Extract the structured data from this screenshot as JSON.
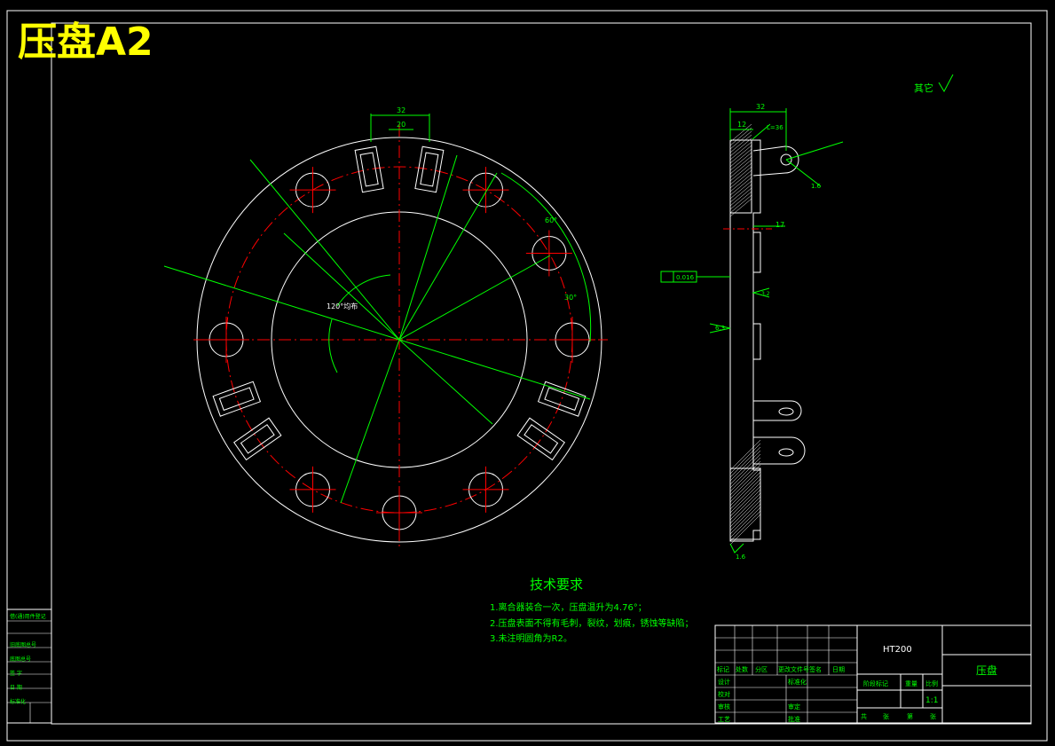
{
  "drawing": {
    "sheet_title": "压盘A2",
    "roughness_note": "其它",
    "part_name": "压盘",
    "material": "HT200"
  },
  "tech_requirements": {
    "heading": "技术要求",
    "items": [
      "1.离合器装合一次，压盘温升为4.76°；",
      "2.压盘表面不得有毛刺，裂纹，划痕，锈蚀等缺陷；",
      "3.未注明圆角为R2。"
    ]
  },
  "dimensions": {
    "slot_outer_width": "32",
    "slot_inner_width": "20",
    "side_total_width": "32",
    "side_step_width": "12",
    "side_depth": "17",
    "angle_60": "60°",
    "angle_30": "30°",
    "angle_120": "120°均布",
    "flatness_value": "0.016",
    "roughness_16": "1.6",
    "roughness_63": "6.3",
    "roughness_32": "3.2",
    "chamfer": "L=36"
  },
  "title_block": {
    "header_cols": [
      "标记",
      "处数",
      "分区",
      "更改文件号",
      "签名",
      "日期"
    ],
    "rows": [
      "设计",
      "校对",
      "审核",
      "工艺"
    ],
    "right_labels": [
      "标准化",
      "",
      "审定",
      "批准"
    ],
    "stage_labels": [
      "阶段标记",
      "重量",
      "比例"
    ],
    "scale": "1:1",
    "sheet_info": [
      "共",
      "张",
      "第",
      "张"
    ]
  },
  "side_block": {
    "labels": [
      "借(通)用件登记",
      "",
      "旧底图总号",
      "底图总号",
      "签 字",
      "日 期",
      "标准化"
    ]
  }
}
